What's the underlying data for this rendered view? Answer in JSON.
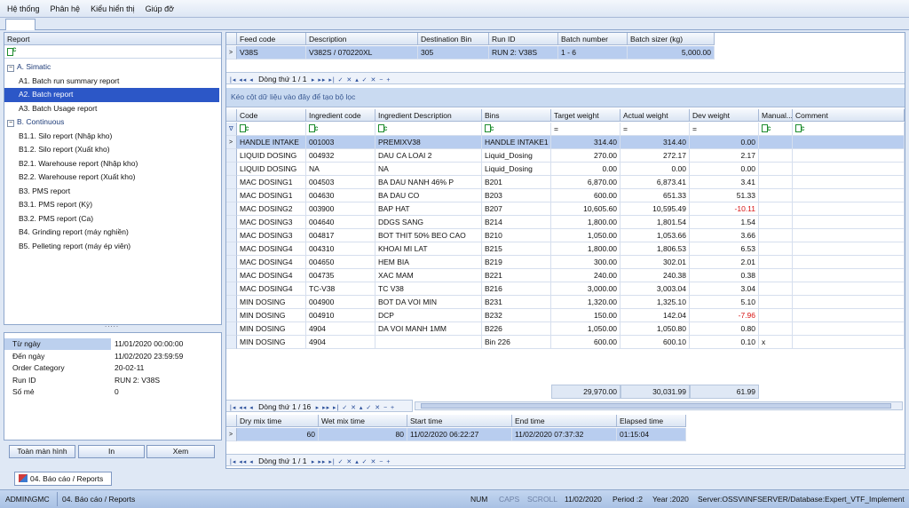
{
  "menu": [
    "Hệ thống",
    "Phân hệ",
    "Kiểu hiển thị",
    "Giúp đỡ"
  ],
  "report_panel": {
    "header": "Report",
    "groups": [
      {
        "label": "A. Simatic",
        "items": [
          "A1. Batch run summary report",
          "A2. Batch report",
          "A3. Batch Usage report"
        ]
      },
      {
        "label": "B. Continuous",
        "items": [
          "B1.1. Silo report (Nhập kho)",
          "B1.2. Silo report (Xuất kho)",
          "B2.1. Warehouse report (Nhập kho)",
          "B2.2. Warehouse report (Xuất kho)",
          "B3. PMS report",
          "B3.1. PMS report (Kỳ)",
          "B3.2. PMS report (Ca)",
          "B4. Grinding report (máy nghiền)",
          "B5. Pelleting report (máy ép viên)"
        ]
      }
    ],
    "selected": "A2. Batch report"
  },
  "params": [
    {
      "label": "Từ ngày",
      "value": "11/01/2020 00:00:00"
    },
    {
      "label": "Đến ngày",
      "value": "11/02/2020 23:59:59"
    },
    {
      "label": "Order Category",
      "value": "20-02-11"
    },
    {
      "label": "Run ID",
      "value": "RUN 2: V38S"
    },
    {
      "label": "Số mẻ",
      "value": "0"
    }
  ],
  "buttons": {
    "fullscreen": "Toàn màn hình",
    "print": "In",
    "view": "Xem"
  },
  "top_grid": {
    "columns": [
      "Feed code",
      "Description",
      "Destination Bin",
      "Run ID",
      "Batch number",
      "Batch sizer (kg)"
    ],
    "row": [
      "V38S",
      "V382S / 070220XL",
      "305",
      "RUN 2: V38S",
      "1 - 6",
      "5,000.00"
    ],
    "nav": "Dòng thứ 1 / 1"
  },
  "group_hint": "Kéo cột dữ liệu vào đây để tạo bộ lọc",
  "main_grid": {
    "columns": [
      "Code",
      "Ingredient code",
      "Ingredient Description",
      "Bins",
      "Target weight",
      "Actual weight",
      "Dev weight",
      "Manual...",
      "Comment"
    ],
    "filter_eq": "=",
    "rows": [
      [
        "HANDLE INTAKE",
        "001003",
        "PREMIXV38",
        "HANDLE INTAKE1",
        "314.40",
        "314.40",
        "0.00",
        ""
      ],
      [
        "LIQUID DOSING",
        "004932",
        "DAU CA LOAI 2",
        "Liquid_Dosing",
        "270.00",
        "272.17",
        "2.17",
        ""
      ],
      [
        "LIQUID DOSING",
        "NA",
        "NA",
        "Liquid_Dosing",
        "0.00",
        "0.00",
        "0.00",
        ""
      ],
      [
        "MAC DOSING1",
        "004503",
        "BA DAU NANH 46% P",
        "B201",
        "6,870.00",
        "6,873.41",
        "3.41",
        ""
      ],
      [
        "MAC DOSING1",
        "004630",
        "BA DAU CO",
        "B203",
        "600.00",
        "651.33",
        "51.33",
        ""
      ],
      [
        "MAC DOSING2",
        "003900",
        "BAP HAT",
        "B207",
        "10,605.60",
        "10,595.49",
        "-10.11",
        ""
      ],
      [
        "MAC DOSING3",
        "004640",
        "DDGS SANG",
        "B214",
        "1,800.00",
        "1,801.54",
        "1.54",
        ""
      ],
      [
        "MAC DOSING3",
        "004817",
        "BOT THIT 50% BEO CAO",
        "B210",
        "1,050.00",
        "1,053.66",
        "3.66",
        ""
      ],
      [
        "MAC DOSING4",
        "004310",
        "KHOAI MI LAT",
        "B215",
        "1,800.00",
        "1,806.53",
        "6.53",
        ""
      ],
      [
        "MAC DOSING4",
        "004650",
        "HEM BIA",
        "B219",
        "300.00",
        "302.01",
        "2.01",
        ""
      ],
      [
        "MAC DOSING4",
        "004735",
        "XAC MAM",
        "B221",
        "240.00",
        "240.38",
        "0.38",
        ""
      ],
      [
        "MAC DOSING4",
        "TC-V38",
        "TC V38",
        "B216",
        "3,000.00",
        "3,003.04",
        "3.04",
        ""
      ],
      [
        "MIN DOSING",
        "004900",
        "BOT DA VOI MIN",
        "B231",
        "1,320.00",
        "1,325.10",
        "5.10",
        ""
      ],
      [
        "MIN DOSING",
        "004910",
        "DCP",
        "B232",
        "150.00",
        "142.04",
        "-7.96",
        ""
      ],
      [
        "MIN DOSING",
        "4904",
        "DA VOI MANH 1MM",
        "B226",
        "1,050.00",
        "1,050.80",
        "0.80",
        ""
      ],
      [
        "MIN DOSING",
        "4904",
        "",
        "Bin 226",
        "600.00",
        "600.10",
        "0.10",
        "x"
      ]
    ],
    "totals": {
      "target": "29,970.00",
      "actual": "30,031.99",
      "dev": "61.99"
    },
    "nav": "Dòng thứ 1 / 16"
  },
  "bottom_grid": {
    "columns": [
      "Dry mix time",
      "Wet mix time",
      "Start time",
      "End time",
      "Elapsed time"
    ],
    "row": [
      "60",
      "80",
      "11/02/2020 06:22:27",
      "11/02/2020 07:37:32",
      "01:15:04"
    ],
    "nav": "Dòng thứ 1 / 1"
  },
  "bottom_tab": "04. Báo cáo / Reports",
  "status": {
    "user": "ADMIN\\GMC",
    "module": "04. Báo cáo / Reports",
    "num": "NUM",
    "caps": "CAPS",
    "scroll": "SCROLL",
    "date": "11/02/2020",
    "period": "Period :2",
    "year": "Year :2020",
    "server": "Server:OSSV\\INFSERVER/Database:Expert_VTF_Implement"
  }
}
